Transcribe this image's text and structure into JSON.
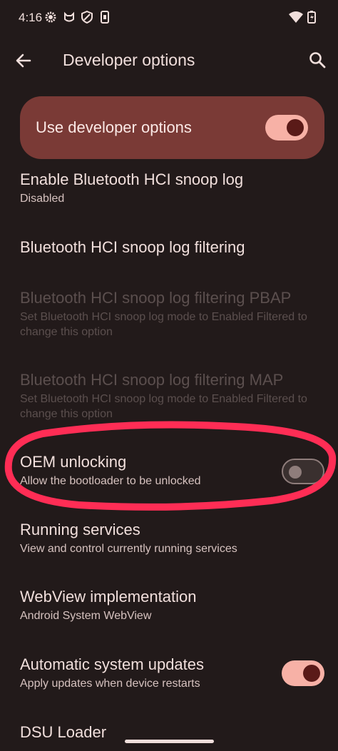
{
  "status": {
    "time": "4:16"
  },
  "header": {
    "title": "Developer options"
  },
  "master": {
    "label": "Use developer options",
    "enabled": true
  },
  "items": [
    {
      "title": "Enable Bluetooth HCI snoop log",
      "subtitle": "Disabled"
    },
    {
      "title": "Bluetooth HCI snoop log filtering",
      "subtitle": ""
    },
    {
      "title": "Bluetooth HCI snoop log filtering PBAP",
      "subtitle": "Set Bluetooth HCI snoop log mode to Enabled Filtered to change this option",
      "disabled": true
    },
    {
      "title": "Bluetooth HCI snoop log filtering MAP",
      "subtitle": "Set Bluetooth HCI snoop log mode to Enabled Filtered to change this option",
      "disabled": true
    },
    {
      "title": "OEM unlocking",
      "subtitle": "Allow the bootloader to be unlocked",
      "toggle": false
    },
    {
      "title": "Running services",
      "subtitle": "View and control currently running services"
    },
    {
      "title": "WebView implementation",
      "subtitle": "Android System WebView"
    },
    {
      "title": "Automatic system updates",
      "subtitle": "Apply updates when device restarts",
      "toggle": true
    },
    {
      "title": "DSU Loader",
      "subtitle": ""
    }
  ],
  "colors": {
    "background": "#221a1a",
    "accent": "#f7b1a6",
    "master_bg": "#7a3a36",
    "annotation": "#ff2d55"
  }
}
